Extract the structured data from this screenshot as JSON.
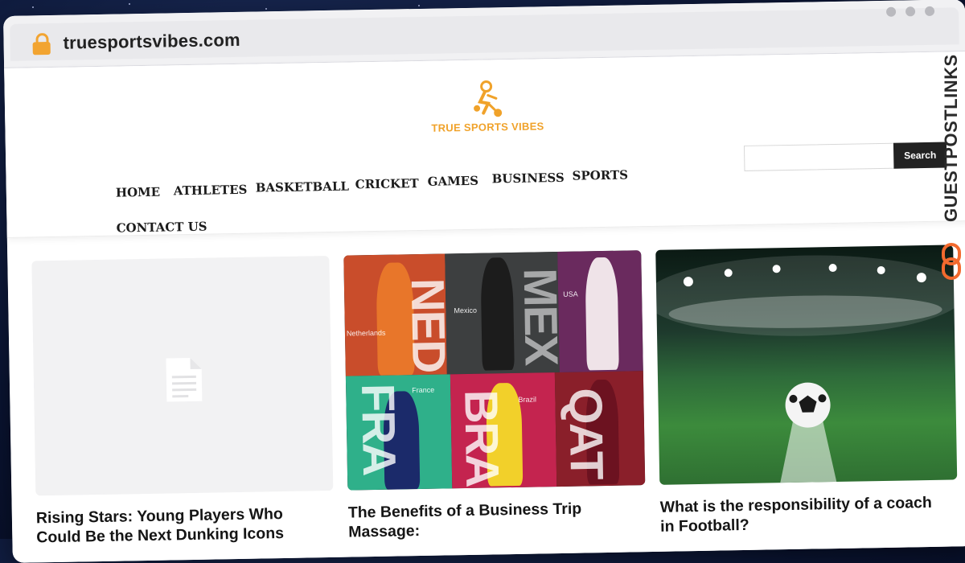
{
  "browser": {
    "url": "truesportsvibes.com",
    "lock_icon": "lock-icon",
    "window_controls": [
      "dot-1",
      "dot-2",
      "dot-3"
    ]
  },
  "site": {
    "logo_text": "TRUE SPORTS VIBES",
    "brand_color": "#f0a22a"
  },
  "nav": {
    "items": [
      "HOME",
      "ATHLETES",
      "BASKETBALL",
      "CRICKET",
      "GAMES",
      "BUSINESS",
      "SPORTS",
      "CONTACT US"
    ]
  },
  "search": {
    "placeholder": "",
    "button_label": "Search"
  },
  "articles": [
    {
      "title": "Rising Stars: Young Players Who Could Be the Next Dunking Icons",
      "image": "placeholder-document-icon"
    },
    {
      "title": "The Benefits of a Business Trip Massage:",
      "image": "world-cup-player-collage",
      "tiles": [
        "NED",
        "MEX",
        "USA",
        "FRA",
        "BRA",
        "QAT"
      ],
      "tile_countries": [
        "Netherlands",
        "Mexico",
        "USA",
        "France",
        "Brazil"
      ]
    },
    {
      "title": "What is the responsibility of a coach in Football?",
      "image": "stadium-football"
    }
  ],
  "watermark": {
    "text": "GUESTPOSTLINKS",
    "icon": "link-icon"
  }
}
